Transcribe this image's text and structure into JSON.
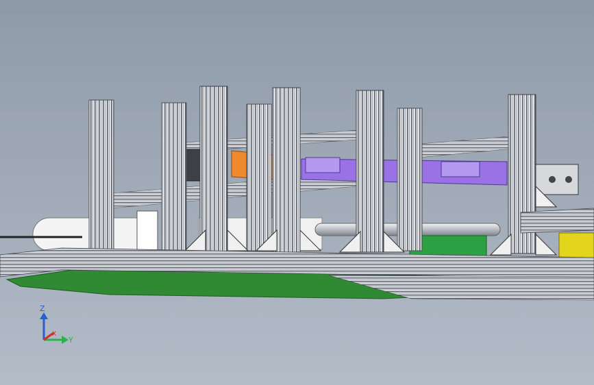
{
  "viewport": {
    "background_top": "#8f9aa9",
    "background_bottom": "#b3bcc7"
  },
  "colors": {
    "extrusion": "#d8dade",
    "extrusion_dark": "#6c7078",
    "plate_green": "#2f8a33",
    "rail_purple": "#9a72e6",
    "bracket_orange": "#f08a2c",
    "box_yellow": "#e3d51c",
    "box_green": "#2da044",
    "ring_white": "#f4f4f4"
  },
  "triad": {
    "z_label": "Z",
    "x_label": "X",
    "y_label": "Y",
    "z_color": "#2b5cd6",
    "x_color": "#d42b2b",
    "y_color": "#2bb34a"
  }
}
